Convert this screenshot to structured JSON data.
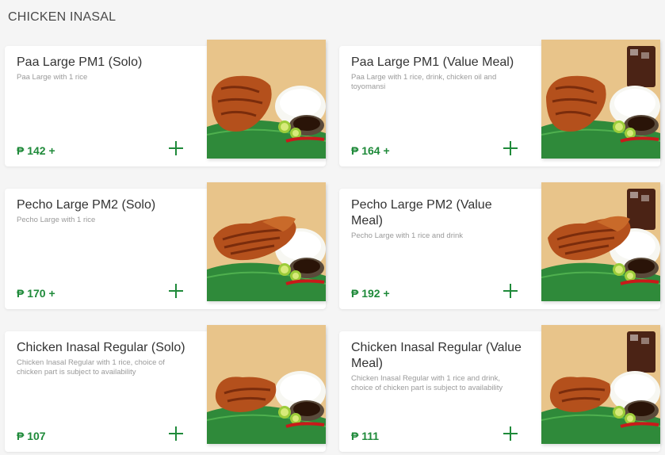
{
  "section": {
    "title": "CHICKEN INASAL"
  },
  "items": [
    {
      "title": "Paa Large PM1 (Solo)",
      "desc": "Paa Large with 1 rice",
      "price": "₱ 142 +",
      "add_icon": "plus-icon",
      "image": "grilled-chicken-leg-with-rice"
    },
    {
      "title": "Paa Large PM1 (Value Meal)",
      "desc": "Paa Large with 1 rice, drink, chicken oil and toyomansi",
      "price": "₱ 164 +",
      "add_icon": "plus-icon",
      "image": "grilled-chicken-leg-with-rice-and-drink"
    },
    {
      "title": "Pecho Large PM2 (Solo)",
      "desc": "Pecho Large with 1 rice",
      "price": "₱ 170 +",
      "add_icon": "plus-icon",
      "image": "grilled-chicken-breast-with-rice"
    },
    {
      "title": "Pecho Large PM2 (Value Meal)",
      "desc": "Pecho Large with 1 rice and drink",
      "price": "₱ 192 +",
      "add_icon": "plus-icon",
      "image": "grilled-chicken-breast-with-rice-and-drink"
    },
    {
      "title": "Chicken Inasal Regular (Solo)",
      "desc": "Chicken Inasal Regular with 1 rice, choice of chicken part is subject to availability",
      "price": "₱ 107",
      "add_icon": "plus-icon",
      "image": "grilled-chicken-regular-with-rice"
    },
    {
      "title": "Chicken Inasal Regular (Value Meal)",
      "desc": "Chicken Inasal Regular with 1 rice and drink, choice of chicken part is subject to availability",
      "price": "₱ 111",
      "add_icon": "plus-icon",
      "image": "grilled-chicken-regular-with-rice-and-drink"
    }
  ],
  "colors": {
    "accent": "#1f8a3a",
    "background": "#f5f5f5",
    "card": "#ffffff"
  }
}
